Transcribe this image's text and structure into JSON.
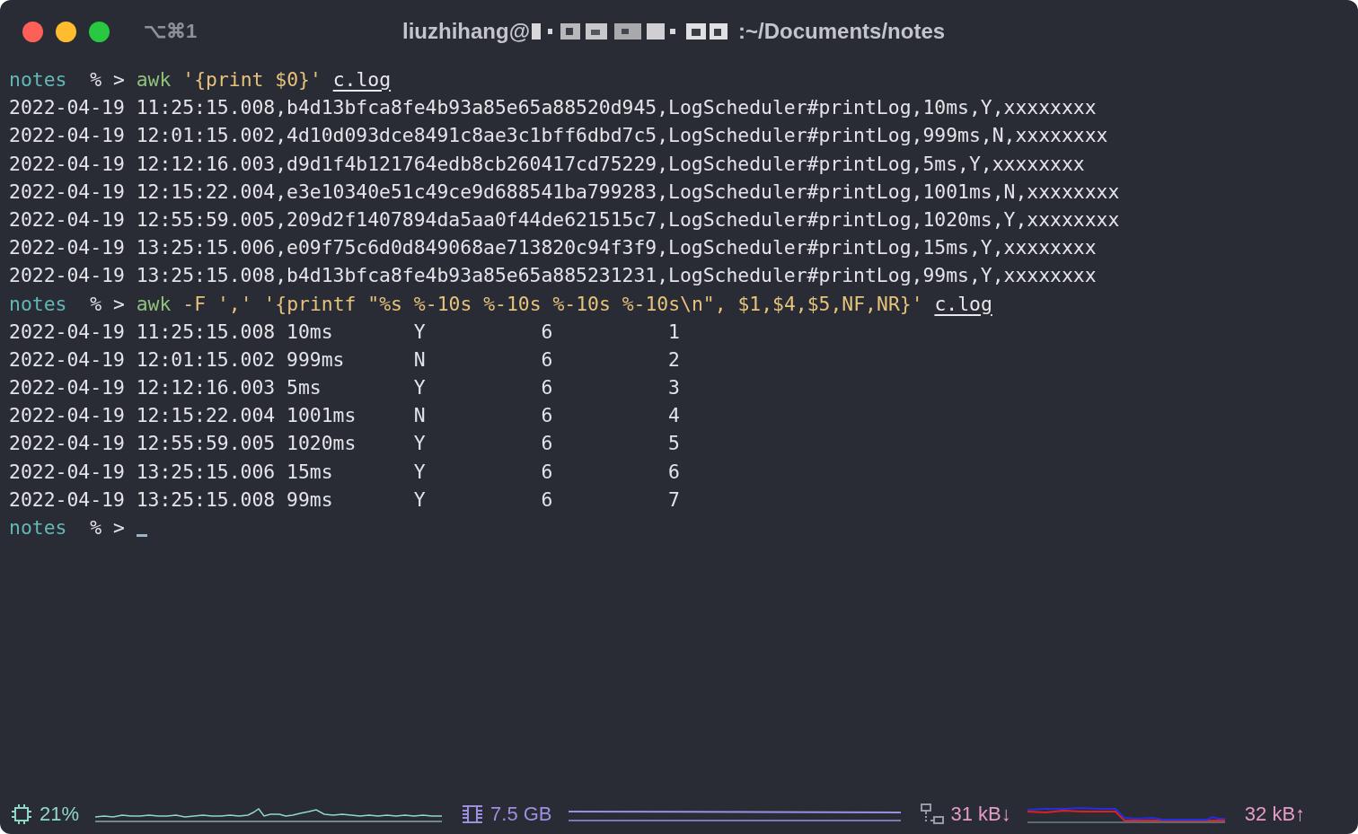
{
  "window": {
    "shortcut": "⌥⌘1",
    "title_user": "liuzhihang@",
    "title_path": ":~/Documents/notes"
  },
  "terminal": [
    {
      "kind": "prompt",
      "dir": "notes",
      "symbol": "% >",
      "command": [
        {
          "kind": "program",
          "text": "awk"
        },
        {
          "kind": "arg",
          "text": "'{print $0}'"
        },
        {
          "kind": "file",
          "text": "c.log"
        }
      ]
    },
    {
      "kind": "output",
      "text": "2022-04-19 11:25:15.008,b4d13bfca8fe4b93a85e65a88520d945,LogScheduler#printLog,10ms,Y,xxxxxxxx"
    },
    {
      "kind": "output",
      "text": "2022-04-19 12:01:15.002,4d10d093dce8491c8ae3c1bff6dbd7c5,LogScheduler#printLog,999ms,N,xxxxxxxx"
    },
    {
      "kind": "output",
      "text": "2022-04-19 12:12:16.003,d9d1f4b121764edb8cb260417cd75229,LogScheduler#printLog,5ms,Y,xxxxxxxx"
    },
    {
      "kind": "output",
      "text": "2022-04-19 12:15:22.004,e3e10340e51c49ce9d688541ba799283,LogScheduler#printLog,1001ms,N,xxxxxxxx"
    },
    {
      "kind": "output",
      "text": "2022-04-19 12:55:59.005,209d2f1407894da5aa0f44de621515c7,LogScheduler#printLog,1020ms,Y,xxxxxxxx"
    },
    {
      "kind": "output",
      "text": "2022-04-19 13:25:15.006,e09f75c6d0d849068ae713820c94f3f9,LogScheduler#printLog,15ms,Y,xxxxxxxx"
    },
    {
      "kind": "output",
      "text": "2022-04-19 13:25:15.008,b4d13bfca8fe4b93a85e65a885231231,LogScheduler#printLog,99ms,Y,xxxxxxxx"
    },
    {
      "kind": "prompt",
      "dir": "notes",
      "symbol": "% >",
      "command": [
        {
          "kind": "program",
          "text": "awk"
        },
        {
          "kind": "arg",
          "text": "-F"
        },
        {
          "kind": "arg",
          "text": "','"
        },
        {
          "kind": "arg",
          "text": "'{printf \"%s %-10s %-10s %-10s %-10s\\n\", $1,$4,$5,NF,NR}'"
        },
        {
          "kind": "file",
          "text": "c.log"
        }
      ]
    },
    {
      "kind": "output",
      "text": "2022-04-19 11:25:15.008 10ms       Y          6          1"
    },
    {
      "kind": "output",
      "text": "2022-04-19 12:01:15.002 999ms      N          6          2"
    },
    {
      "kind": "output",
      "text": "2022-04-19 12:12:16.003 5ms        Y          6          3"
    },
    {
      "kind": "output",
      "text": "2022-04-19 12:15:22.004 1001ms     N          6          4"
    },
    {
      "kind": "output",
      "text": "2022-04-19 12:55:59.005 1020ms     Y          6          5"
    },
    {
      "kind": "output",
      "text": "2022-04-19 13:25:15.006 15ms       Y          6          6"
    },
    {
      "kind": "output",
      "text": "2022-04-19 13:25:15.008 99ms       Y          6          7"
    },
    {
      "kind": "prompt",
      "dir": "notes",
      "symbol": "% >",
      "cursor": true
    }
  ],
  "status_bar": [
    {
      "kind": "cpu",
      "text": "21%",
      "color": "#8fd9c4"
    },
    {
      "kind": "memory",
      "text": "7.5 GB",
      "color": "#9d8fe0"
    },
    {
      "kind": "network",
      "text": "31 kB↓",
      "color": "#e59cc6"
    },
    {
      "kind": "upload",
      "text": "32 kB↑",
      "color": "#e59cc6"
    }
  ]
}
